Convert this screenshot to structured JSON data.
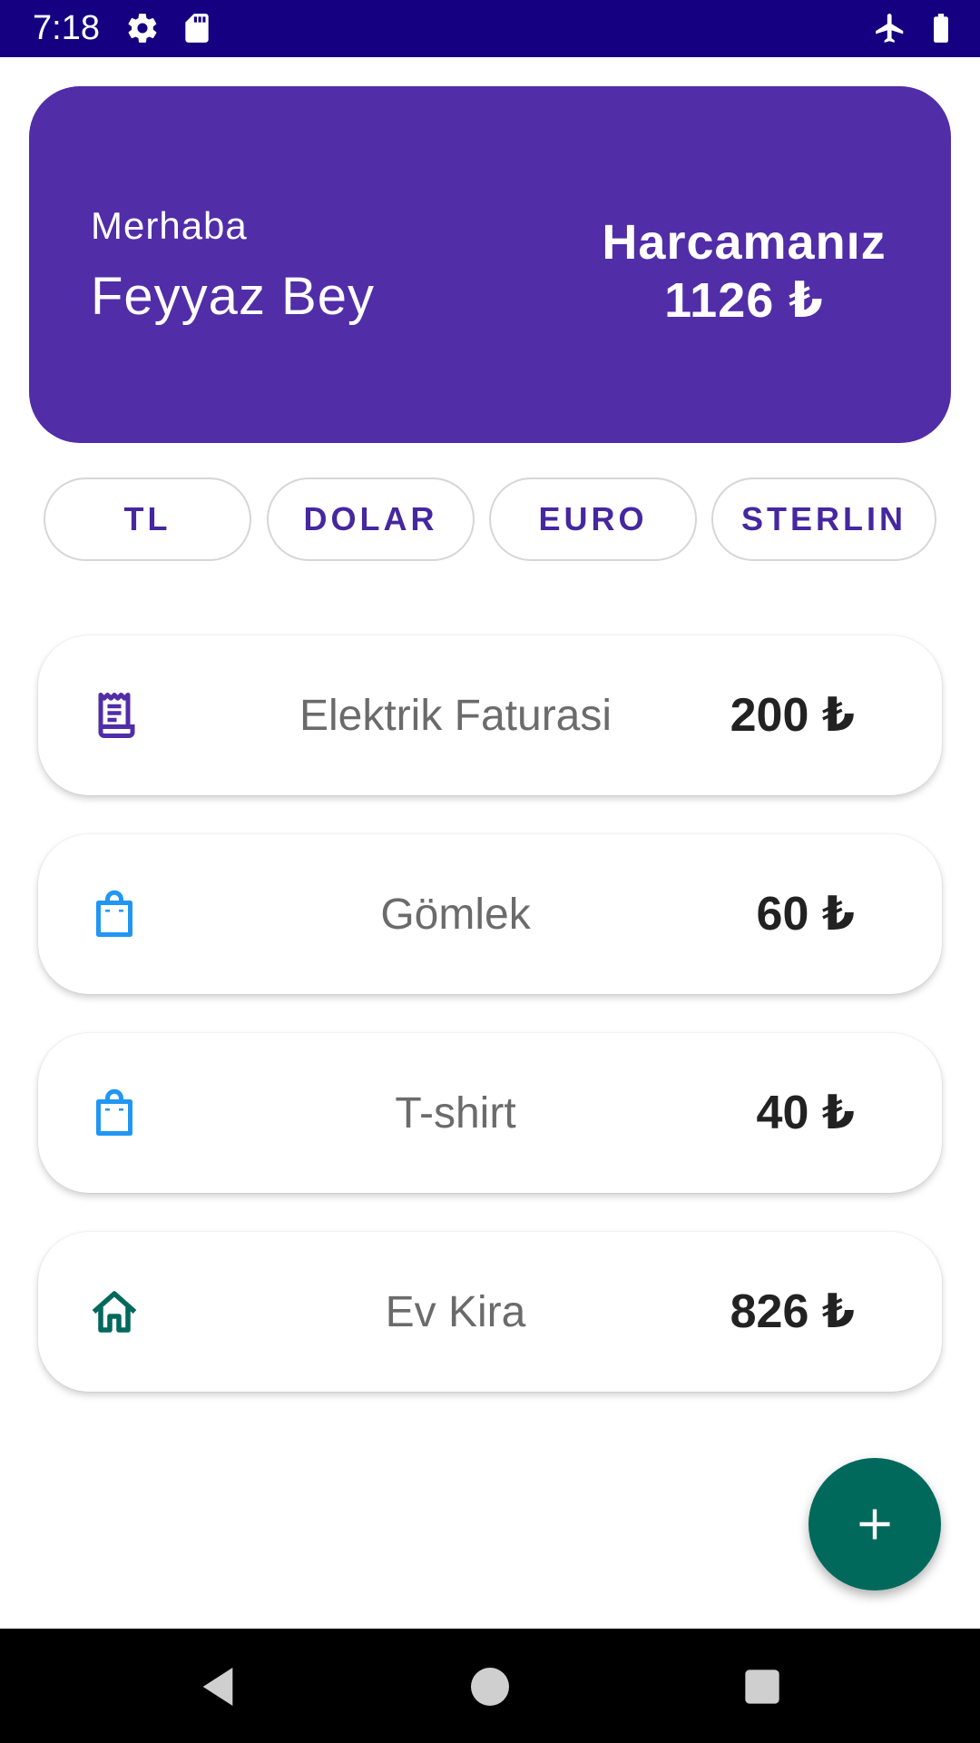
{
  "status_bar": {
    "time": "7:18",
    "icons_left": [
      "gear-icon",
      "sd-card-icon"
    ],
    "icons_right": [
      "airplane-mode-icon",
      "battery-icon"
    ],
    "background_color": "#140080"
  },
  "header": {
    "greeting": "Merhaba",
    "user_name": "Feyyaz Bey",
    "spending_label": "Harcamanız",
    "spending_total": "1126 ₺",
    "background_color": "#512da8"
  },
  "currency_chips": [
    {
      "label": "TL"
    },
    {
      "label": "DOLAR"
    },
    {
      "label": "EURO"
    },
    {
      "label": "STERLIN"
    }
  ],
  "expenses": [
    {
      "icon": "receipt-icon",
      "icon_color": "#512da8",
      "name": "Elektrik Faturasi",
      "amount": "200 ₺"
    },
    {
      "icon": "shopping-bag-icon",
      "icon_color": "#2196f3",
      "name": "Gömlek",
      "amount": "60 ₺"
    },
    {
      "icon": "shopping-bag-icon",
      "icon_color": "#2196f3",
      "name": "T-shirt",
      "amount": "40 ₺"
    },
    {
      "icon": "home-icon",
      "icon_color": "#00695c",
      "name": "Ev Kira",
      "amount": "826 ₺"
    }
  ],
  "fab": {
    "icon": "plus-icon",
    "color": "#00695c"
  },
  "nav_bar": {
    "icons": [
      "back-icon",
      "home-circle-icon",
      "recents-icon"
    ]
  }
}
